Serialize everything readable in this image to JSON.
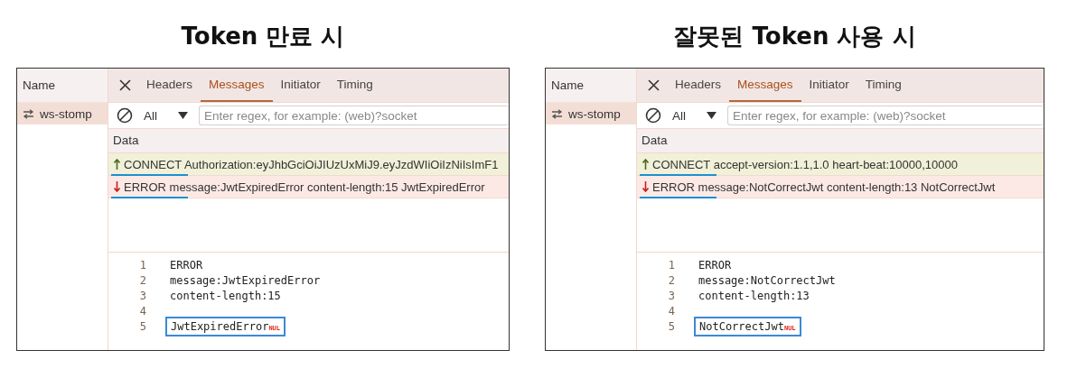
{
  "panels": [
    {
      "title": "Token 만료 시",
      "sidebar": {
        "header": "Name",
        "items": [
          {
            "label": "ws-stomp",
            "selected": true
          }
        ]
      },
      "tabs": [
        {
          "label": "Headers",
          "selected": false
        },
        {
          "label": "Messages",
          "selected": true
        },
        {
          "label": "Initiator",
          "selected": false
        },
        {
          "label": "Timing",
          "selected": false
        }
      ],
      "filter": {
        "type_label": "All",
        "placeholder": "Enter regex, for example: (web)?socket"
      },
      "messages_header": "Data",
      "messages": [
        {
          "kind": "sent",
          "text": "CONNECT Authorization:eyJhbGciOiJIUzUxMiJ9.eyJzdWIiOiIzNiIsImF1",
          "underlined": true
        },
        {
          "kind": "received",
          "text": "ERROR message:JwtExpiredError content-length:15 JwtExpiredError",
          "underlined": true
        }
      ],
      "code_lines": [
        {
          "number": "1",
          "text": "ERROR",
          "boxed": false
        },
        {
          "number": "2",
          "text": "message:JwtExpiredError",
          "boxed": false
        },
        {
          "number": "3",
          "text": "content-length:15",
          "boxed": false
        },
        {
          "number": "4",
          "boxed": false
        },
        {
          "number": "5",
          "text": "JwtExpiredError",
          "nul": "NUL",
          "boxed": true
        }
      ]
    },
    {
      "title": "잘못된 Token 사용 시",
      "sidebar": {
        "header": "Name",
        "items": [
          {
            "label": "ws-stomp",
            "selected": true
          }
        ]
      },
      "tabs": [
        {
          "label": "Headers",
          "selected": false
        },
        {
          "label": "Messages",
          "selected": true
        },
        {
          "label": "Initiator",
          "selected": false
        },
        {
          "label": "Timing",
          "selected": false
        }
      ],
      "filter": {
        "type_label": "All",
        "placeholder": "Enter regex, for example: (web)?socket"
      },
      "messages_header": "Data",
      "messages": [
        {
          "kind": "sent",
          "text": "CONNECT accept-version:1.1,1.0 heart-beat:10000,10000",
          "underlined": true
        },
        {
          "kind": "received",
          "text": "ERROR message:NotCorrectJwt content-length:13 NotCorrectJwt",
          "underlined": true
        }
      ],
      "code_lines": [
        {
          "number": "1",
          "text": "ERROR",
          "boxed": false
        },
        {
          "number": "2",
          "text": "message:NotCorrectJwt",
          "boxed": false
        },
        {
          "number": "3",
          "text": "content-length:13",
          "boxed": false
        },
        {
          "number": "4",
          "boxed": false
        },
        {
          "number": "5",
          "text": "NotCorrectJwt",
          "nul": "NUL",
          "boxed": true
        }
      ]
    }
  ]
}
